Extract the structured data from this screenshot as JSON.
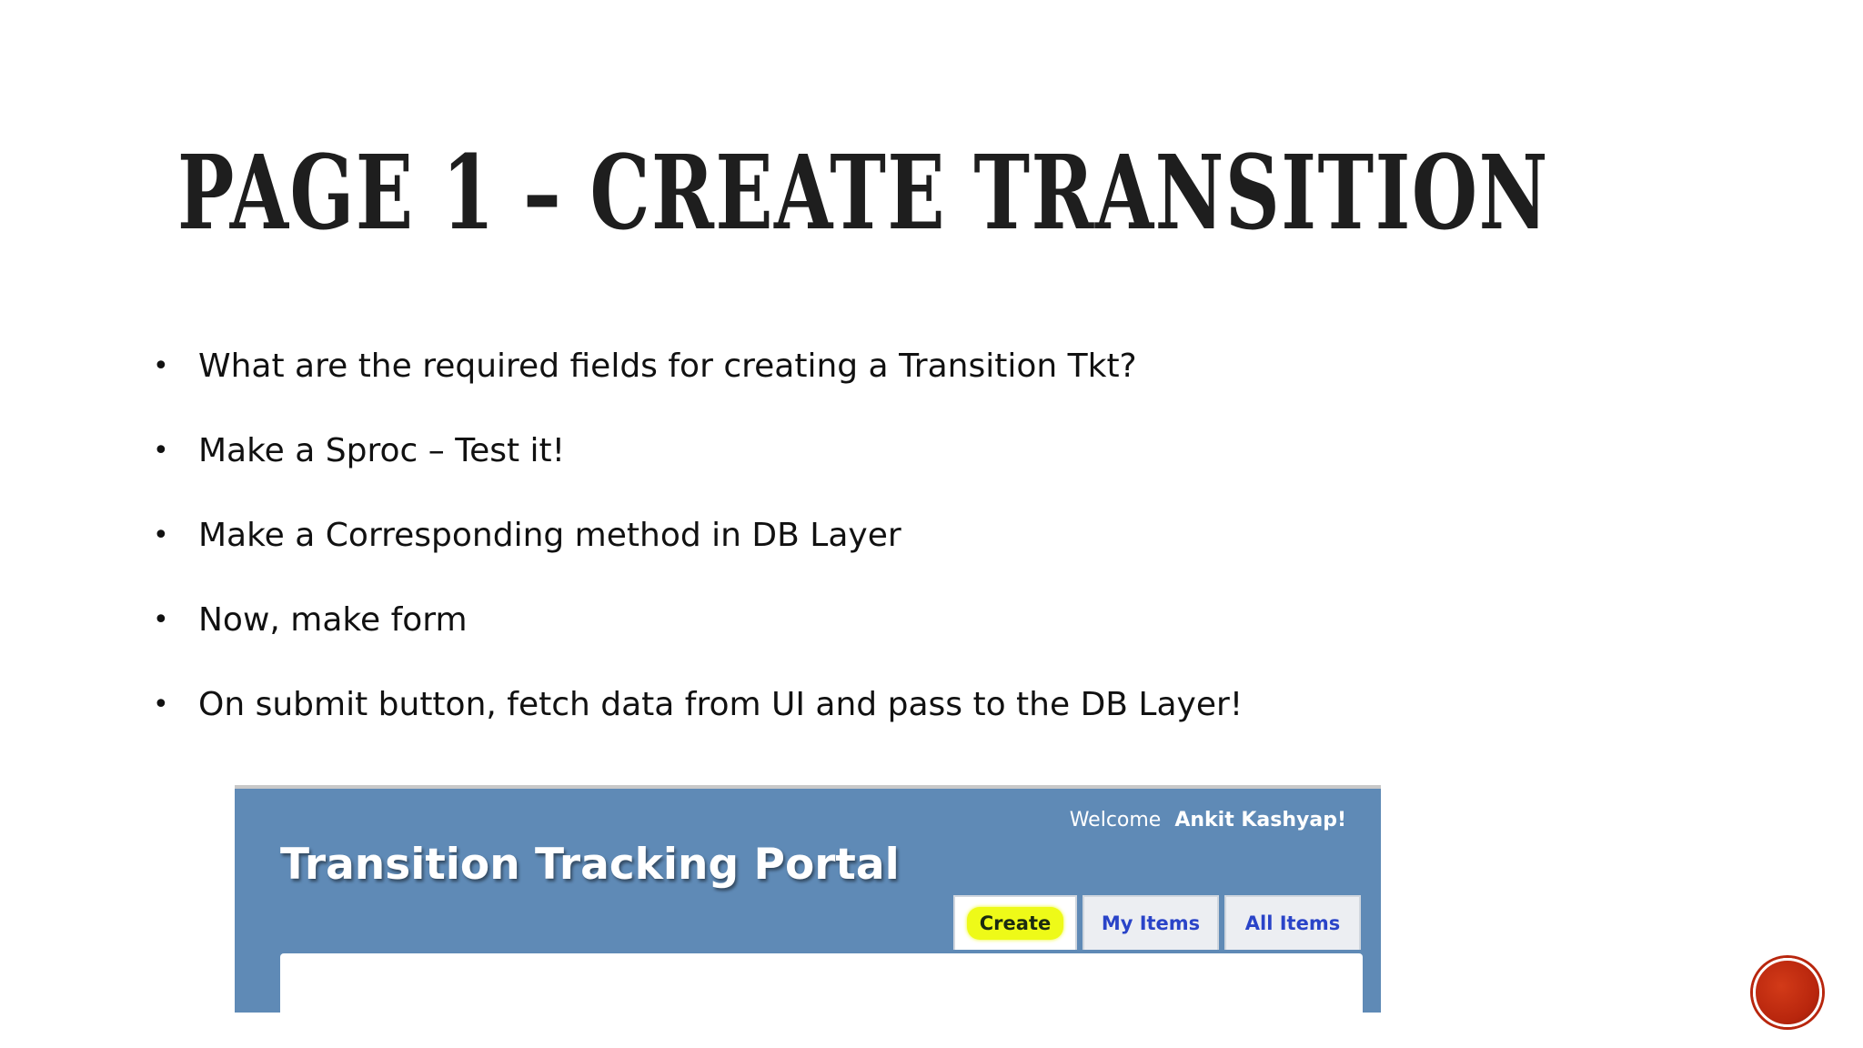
{
  "slide": {
    "title": "Page 1 – Create Transition",
    "bullets": [
      "What are the required fields for creating a Transition Tkt?",
      "Make a Sproc – Test it!",
      "Make a Corresponding method in DB Layer",
      "Now, make form",
      "On submit button, fetch data from UI and pass to the DB Layer!"
    ],
    "bullet_glyph": "•"
  },
  "portal": {
    "title": "Transition Tracking Portal",
    "welcome_prefix": "Welcome",
    "welcome_user": "Ankit Kashyap!",
    "tabs": [
      {
        "label": "Create",
        "active": true,
        "highlighted": true
      },
      {
        "label": "My Items",
        "active": false
      },
      {
        "label": "All Items",
        "active": false
      }
    ],
    "colors": {
      "header_bg": "#5f8ab6",
      "tab_link": "#2a44c8",
      "highlight": "#eefa18"
    }
  },
  "recorder": {
    "icon": "record-button-icon",
    "color": "#b8260d"
  }
}
